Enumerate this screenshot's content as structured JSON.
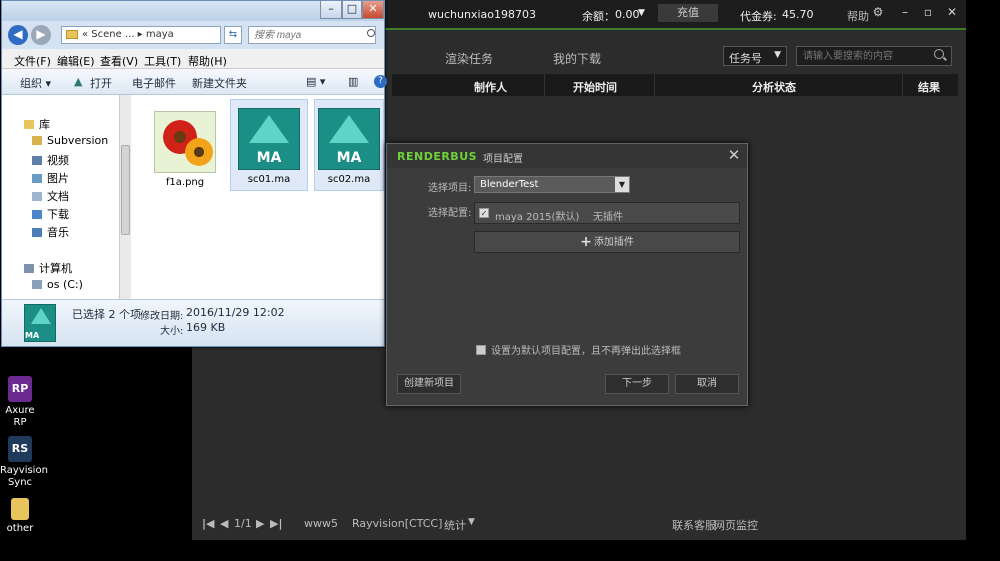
{
  "desktop": {
    "icons": [
      {
        "label": "Axure RP",
        "glyph": "RP"
      },
      {
        "label": "Rayvision Sync",
        "glyph": "RS"
      },
      {
        "label": "other",
        "glyph": ""
      }
    ]
  },
  "renderbus": {
    "username": "wuchunxiao198703",
    "balance_label": "余额：",
    "balance_value": "0.00",
    "recharge": "充值",
    "voucher_label": "代金券:",
    "voucher_value": "45.70",
    "help": "帮助",
    "nav": [
      "渲染任务",
      "我的下载"
    ],
    "filter_select": "任务号",
    "search_placeholder": "请输入要搜索的内容",
    "table_headers": [
      "制作人",
      "开始时间",
      "分析状态",
      "结果"
    ],
    "footer": {
      "page": "1/1",
      "www": "www5",
      "server": "Rayvision[CTCC]",
      "stats": "统计",
      "support": "联系客服",
      "monitor": "网页监控"
    }
  },
  "explorer": {
    "address": "« Scene ... ▸ maya",
    "search_placeholder": "搜索 maya",
    "menu": [
      "文件(F)",
      "编辑(E)",
      "查看(V)",
      "工具(T)",
      "帮助(H)"
    ],
    "toolbar": [
      "组织 ▾",
      "打开",
      "电子邮件",
      "新建文件夹"
    ],
    "nav_items": [
      {
        "label": "库",
        "color": "#e8c45e"
      },
      {
        "label": "Subversion",
        "color": "#d8b24c"
      },
      {
        "label": "视频",
        "color": "#5e7fa8"
      },
      {
        "label": "图片",
        "color": "#6a9bc6"
      },
      {
        "label": "文档",
        "color": "#9fb5cf"
      },
      {
        "label": "下载",
        "color": "#4b86c8"
      },
      {
        "label": "音乐",
        "color": "#4c7fb8"
      },
      {
        "label": "计算机",
        "color": "#7d93ac"
      },
      {
        "label": "os (C:)",
        "color": "#8aa0b8"
      }
    ],
    "files": [
      {
        "name": "f1a.png",
        "kind": "image"
      },
      {
        "name": "sc01.ma",
        "kind": "ma"
      },
      {
        "name": "sc02.ma",
        "kind": "ma"
      }
    ],
    "ma_label": "MA",
    "status": {
      "selected": "已选择 2 个项",
      "modified_label": "修改日期:",
      "modified_value": "2016/11/29 12:02",
      "size_label": "大小:",
      "size_value": "169 KB"
    }
  },
  "dialog": {
    "logo": "RENDERBUS",
    "title": "项目配置",
    "select_project_label": "选择项目:",
    "project_value": "BlenderTest",
    "select_config_label": "选择配置:",
    "config_name": "maya 2015(默认)",
    "config_plugin": "无插件",
    "add_plugin": "添加插件",
    "default_checkbox": "设置为默认项目配置，且不再弹出此选择框",
    "btn_new": "创建新项目",
    "btn_next": "下一步",
    "btn_cancel": "取消"
  }
}
